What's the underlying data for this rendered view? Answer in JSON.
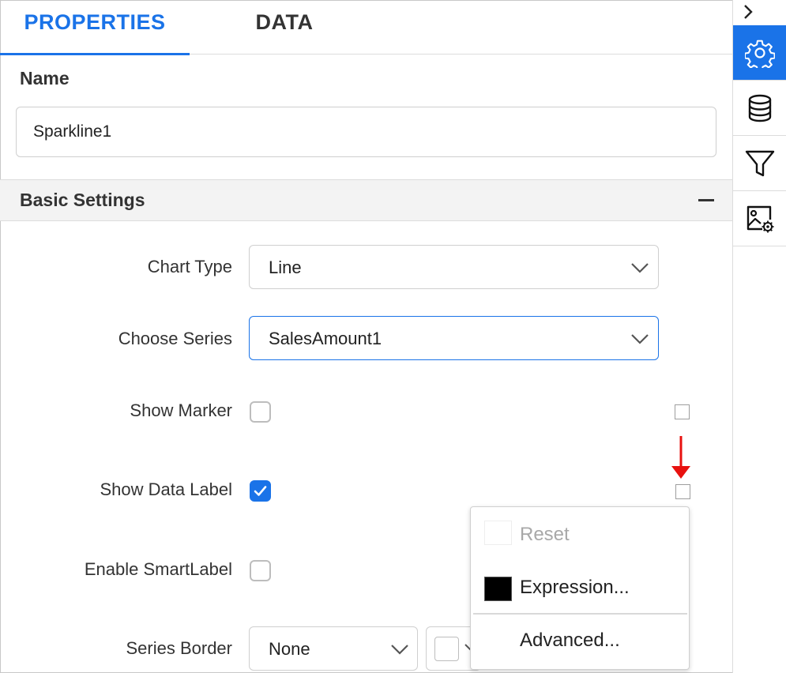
{
  "tabs": {
    "properties": "PROPERTIES",
    "data": "DATA",
    "active": "PROPERTIES"
  },
  "name": {
    "label": "Name",
    "value": "Sparkline1"
  },
  "basic_settings": {
    "title": "Basic Settings",
    "chart_type": {
      "label": "Chart Type",
      "value": "Line"
    },
    "choose_series": {
      "label": "Choose Series",
      "value": "SalesAmount1"
    },
    "show_marker": {
      "label": "Show Marker",
      "checked": false
    },
    "show_data_label": {
      "label": "Show Data Label",
      "checked": true
    },
    "enable_smart_label": {
      "label": "Enable SmartLabel",
      "checked": false
    },
    "series_border": {
      "label": "Series Border",
      "value": "None"
    }
  },
  "context_menu": {
    "reset": "Reset",
    "expression": "Expression...",
    "advanced": "Advanced..."
  },
  "colors": {
    "accent": "#1a73e8",
    "arrow": "#e8110f",
    "section_bg": "#f3f3f3",
    "border": "#cfcfcf"
  },
  "icons": {
    "rail_toggle": "chevron-right-icon",
    "properties": "gear-icon",
    "data": "database-icon",
    "filter": "filter-icon",
    "image_settings": "image-settings-icon"
  }
}
